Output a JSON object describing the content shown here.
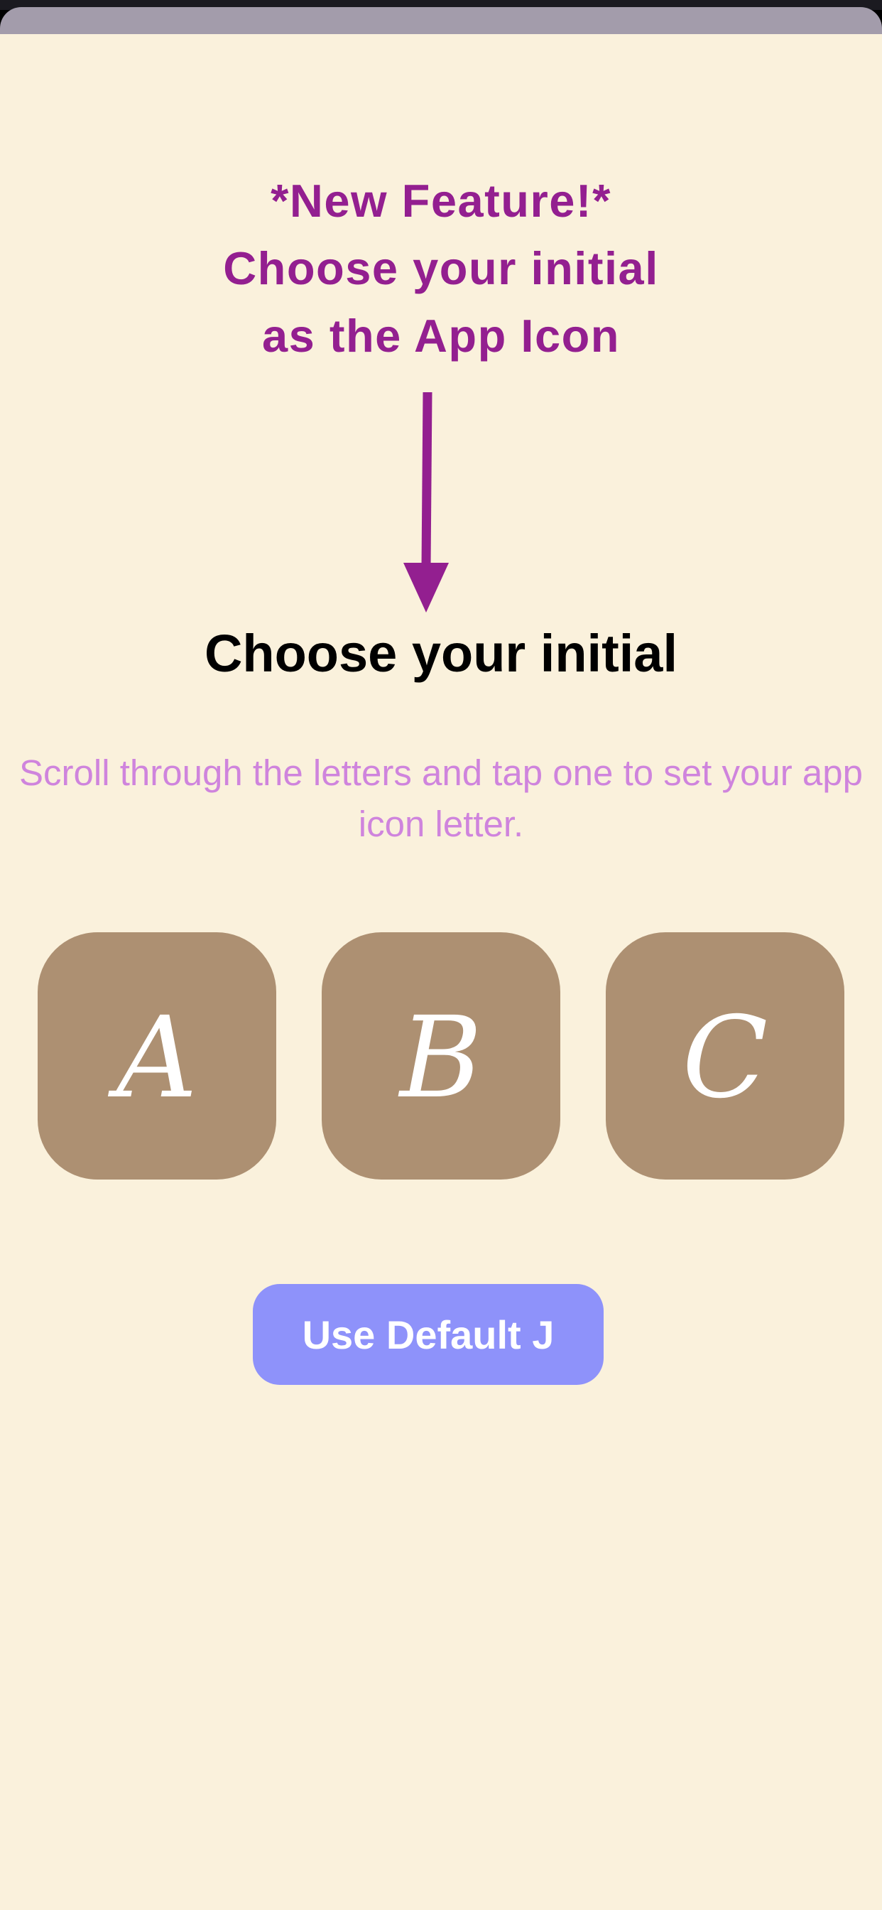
{
  "colors": {
    "background": "#faf1dc",
    "promo_text": "#931f90",
    "subtitle_text": "#cf84dd",
    "tile_fill": "#ad9072",
    "button_fill": "#8e92fa",
    "sheet_header": "#a39cab"
  },
  "promo": {
    "line1": "*New Feature!*",
    "line2": "Choose your initial",
    "line3": "as the App Icon",
    "arrow_icon": "down-arrow-icon"
  },
  "picker": {
    "title": "Choose your initial",
    "subtitle": "Scroll through the letters and tap one to set your app icon letter.",
    "letters": [
      "A",
      "B",
      "C"
    ]
  },
  "default_button": {
    "label": "Use Default J"
  }
}
